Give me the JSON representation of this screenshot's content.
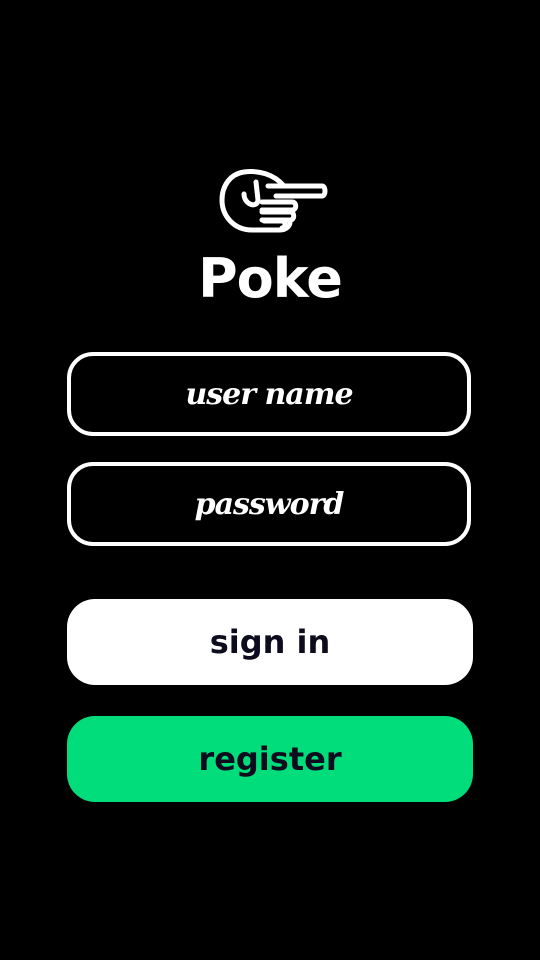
{
  "app": {
    "title": "Poke",
    "logo_icon": "pointing-hand-icon"
  },
  "login_form": {
    "username_placeholder": "user name",
    "password_placeholder": "password",
    "sign_in_label": "sign in",
    "register_label": "register"
  },
  "colors": {
    "background": "#000000",
    "foreground": "#ffffff",
    "register_accent": "#00dd7a",
    "button_text": "#0c0c1e"
  }
}
